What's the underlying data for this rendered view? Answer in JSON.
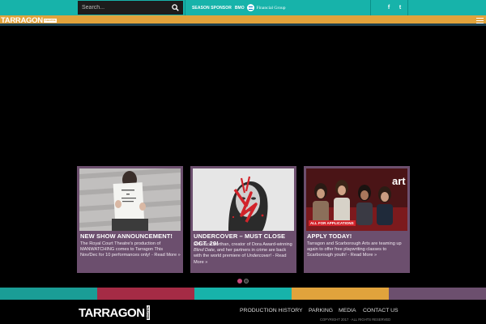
{
  "search": {
    "placeholder": "Search..."
  },
  "sponsor": {
    "label": "SEASON SPONSOR",
    "bank": "BMO",
    "name": "Financial Group"
  },
  "social": [
    {
      "icon": "facebook-icon",
      "glyph": "f"
    },
    {
      "icon": "twitter-icon",
      "glyph": "t"
    }
  ],
  "header": {
    "logo_text": "TARRAGON",
    "logo_tag": "THEATRE"
  },
  "colors": {
    "teal": "#17b3aa",
    "gold": "#e1a33c",
    "purple": "#6c4f6e",
    "red": "#a52b45"
  },
  "cards": [
    {
      "title": "New show announcement!",
      "desc": "The Royal Court Theatre's production of MANWATCHING comes to Tarragon This Nov/Dec for 10 performances only! - Read More »"
    },
    {
      "title": "Undercover – Must close Oct. 29!",
      "desc_prefix": "Rebecca Northan, creator of Dora Award-winning ",
      "desc_em": "Blind Date",
      "desc_mid": ", and her partners in crime are back with the world premiere of ",
      "desc_em2": "Undercover",
      "desc_suffix": "! - Read More »"
    },
    {
      "title": "Apply today!",
      "badge": "ALL FOR APPLICATIONS",
      "logo_word": "art",
      "desc": "Tarragon and Scarborough Arts are teaming up again to offer free playwriting classes to Scarborough youth! - Read More »"
    }
  ],
  "carousel": {
    "pages": 2,
    "active": 1
  },
  "footer": {
    "logo_text": "TARRAGON",
    "logo_tag": "THEATRE",
    "nav": [
      "PRODUCTION HISTORY",
      "PARKING",
      "MEDIA",
      "CONTACT US"
    ],
    "copyright": "COPYRIGHT 2017 · ALL RIGHTS RESERVED"
  },
  "stripe_colors": [
    "#1a9d96",
    "#a52b45",
    "#17b3aa",
    "#e1a33c",
    "#6c4f6e"
  ]
}
